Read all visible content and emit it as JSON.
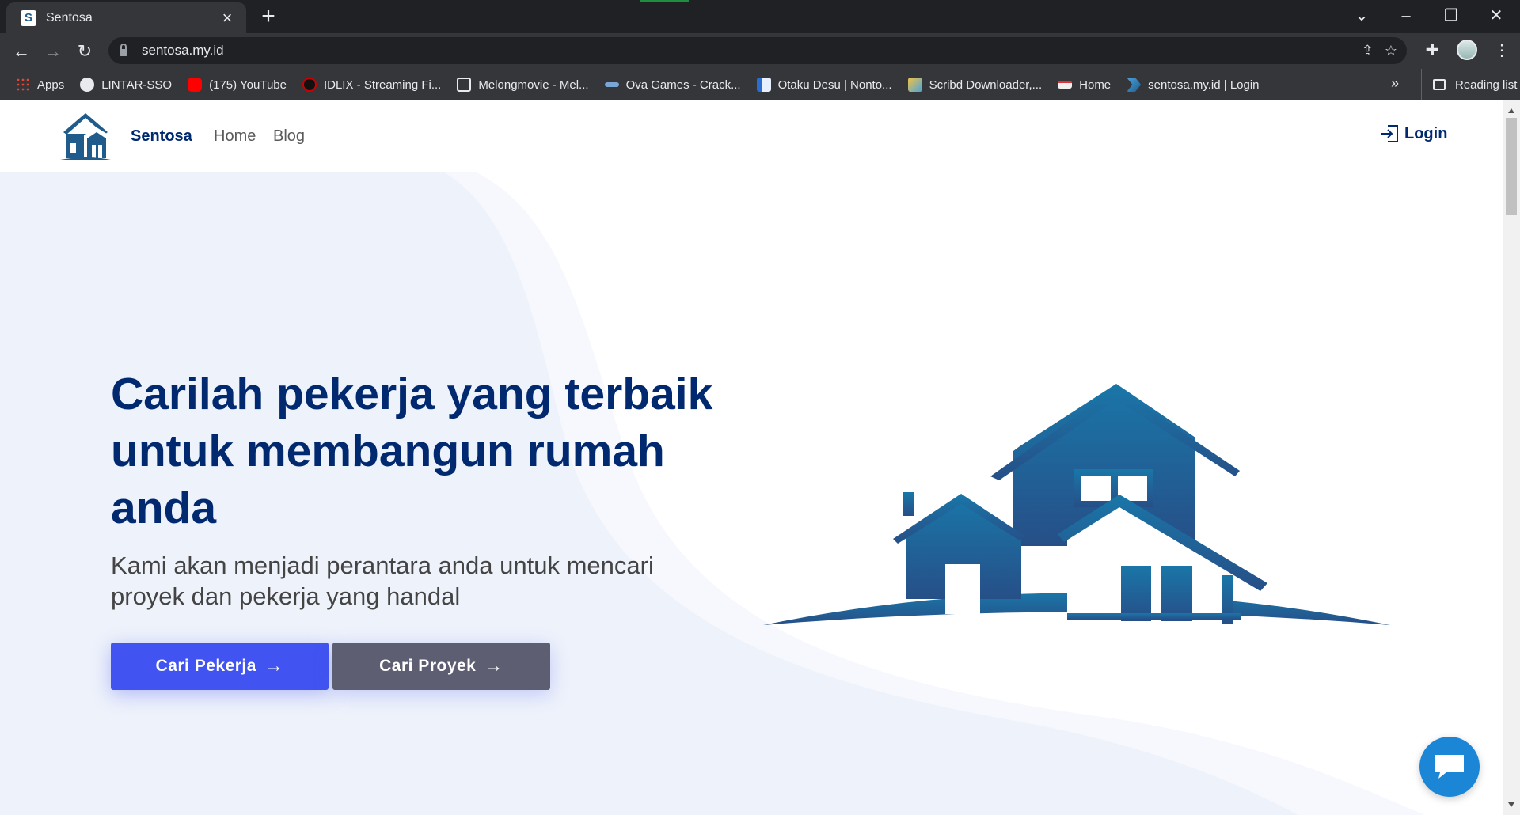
{
  "browser": {
    "tab_title": "Sentosa",
    "tab_favicon": "S",
    "url": "sentosa.my.id",
    "bookmarks": [
      {
        "label": "Apps",
        "icon": "apps-grid-icon"
      },
      {
        "label": "LINTAR-SSO",
        "icon": "globe-icon"
      },
      {
        "label": "(175) YouTube",
        "icon": "youtube-icon"
      },
      {
        "label": "IDLIX - Streaming Fi...",
        "icon": "idlix-icon"
      },
      {
        "label": "Melongmovie - Mel...",
        "icon": "melongmovie-icon"
      },
      {
        "label": "Ova Games - Crack...",
        "icon": "ovagames-icon"
      },
      {
        "label": "Otaku Desu | Nonto...",
        "icon": "otakudesu-icon"
      },
      {
        "label": "Scribd Downloader,...",
        "icon": "scribd-icon"
      },
      {
        "label": "Home",
        "icon": "home-bookmark-icon"
      },
      {
        "label": "sentosa.my.id | Login",
        "icon": "sentosa-bookmark-icon"
      }
    ],
    "more_bookmarks": "»",
    "reading_list": "Reading list"
  },
  "site": {
    "brand": "Sentosa",
    "nav": {
      "home": "Home",
      "blog": "Blog"
    },
    "login": "Login",
    "colors": {
      "primary": "#4154f1",
      "secondary": "#5e5e72",
      "heading": "#012970",
      "house": "#1f5c8c"
    }
  },
  "hero": {
    "title": "Carilah pekerja yang terbaik untuk membangun rumah anda",
    "subtitle": "Kami akan menjadi perantara anda untuk mencari proyek dan pekerja yang handal",
    "btn_workers": "Cari Pekerja",
    "btn_projects": "Cari Proyek",
    "arrow": "→"
  }
}
